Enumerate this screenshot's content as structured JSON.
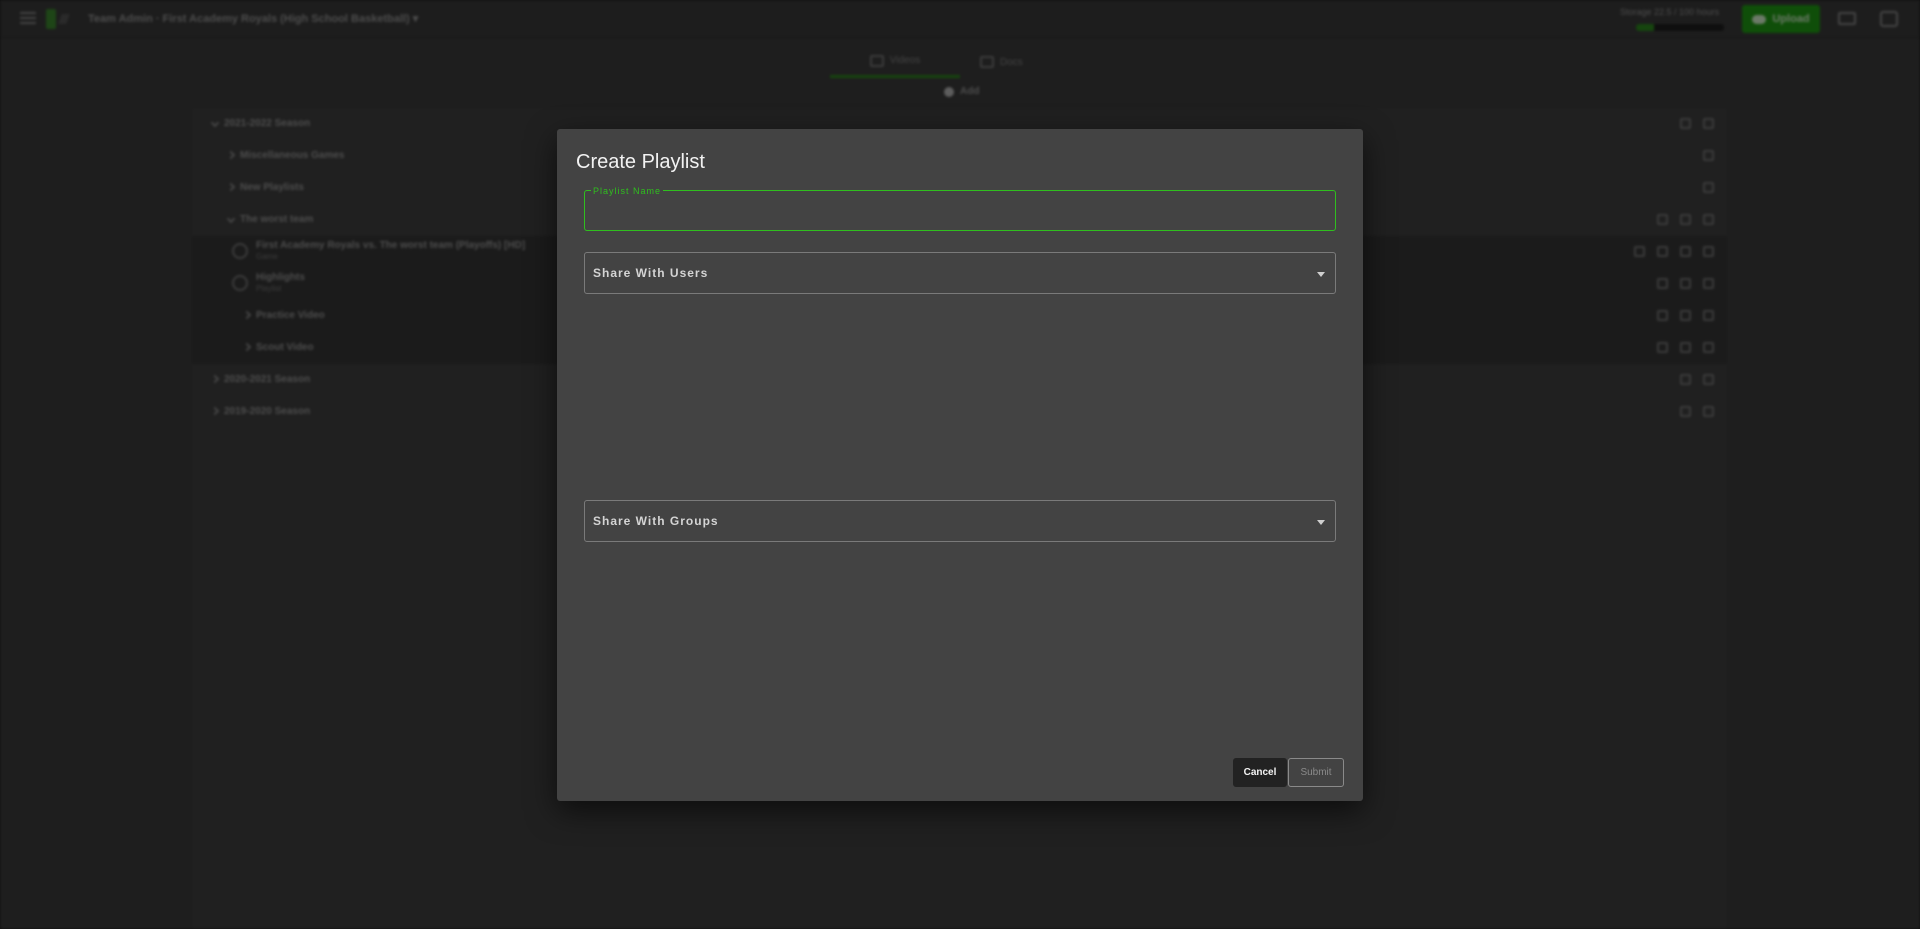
{
  "topbar": {
    "breadcrumb": "Team Admin · First Academy Royals (High School Basketball) ▾",
    "storage_text": "Storage 22.5 / 100 hours",
    "storage_used_fraction": 0.2,
    "upload_label": "Upload"
  },
  "tabs": [
    {
      "label": "Videos",
      "active": true
    },
    {
      "label": "Docs",
      "active": false
    }
  ],
  "add_label": "Add",
  "tree": [
    {
      "label": "2021-2022 Season",
      "depth": 0,
      "expanded": true
    },
    {
      "label": "Miscellaneous Games",
      "depth": 1,
      "expanded": false
    },
    {
      "label": "New Playlists",
      "depth": 1,
      "expanded": false
    },
    {
      "label": "The worst team",
      "depth": 1,
      "expanded": true
    },
    {
      "label": "First Academy Royals vs. The worst team (Playoffs) [HD]",
      "sub": "Game",
      "depth": 2,
      "type": "video"
    },
    {
      "label": "Highlights",
      "sub": "Playlist",
      "depth": 2,
      "type": "video"
    },
    {
      "label": "Practice Video",
      "depth": 2,
      "expanded": false
    },
    {
      "label": "Scout Video",
      "depth": 2,
      "expanded": false
    },
    {
      "label": "2020-2021 Season",
      "depth": 0,
      "expanded": false
    },
    {
      "label": "2019-2020 Season",
      "depth": 0,
      "expanded": false
    }
  ],
  "dialog": {
    "title": "Create Playlist",
    "name_field": {
      "label": "Playlist Name",
      "value": "",
      "placeholder": ""
    },
    "share_users": {
      "label": "Share With Users"
    },
    "share_groups": {
      "label": "Share With Groups"
    },
    "cancel_label": "Cancel",
    "submit_label": "Submit"
  },
  "colors": {
    "accent": "#2fbf1e",
    "dialog_bg": "#434343",
    "upload_bg": "#1f9d12"
  }
}
